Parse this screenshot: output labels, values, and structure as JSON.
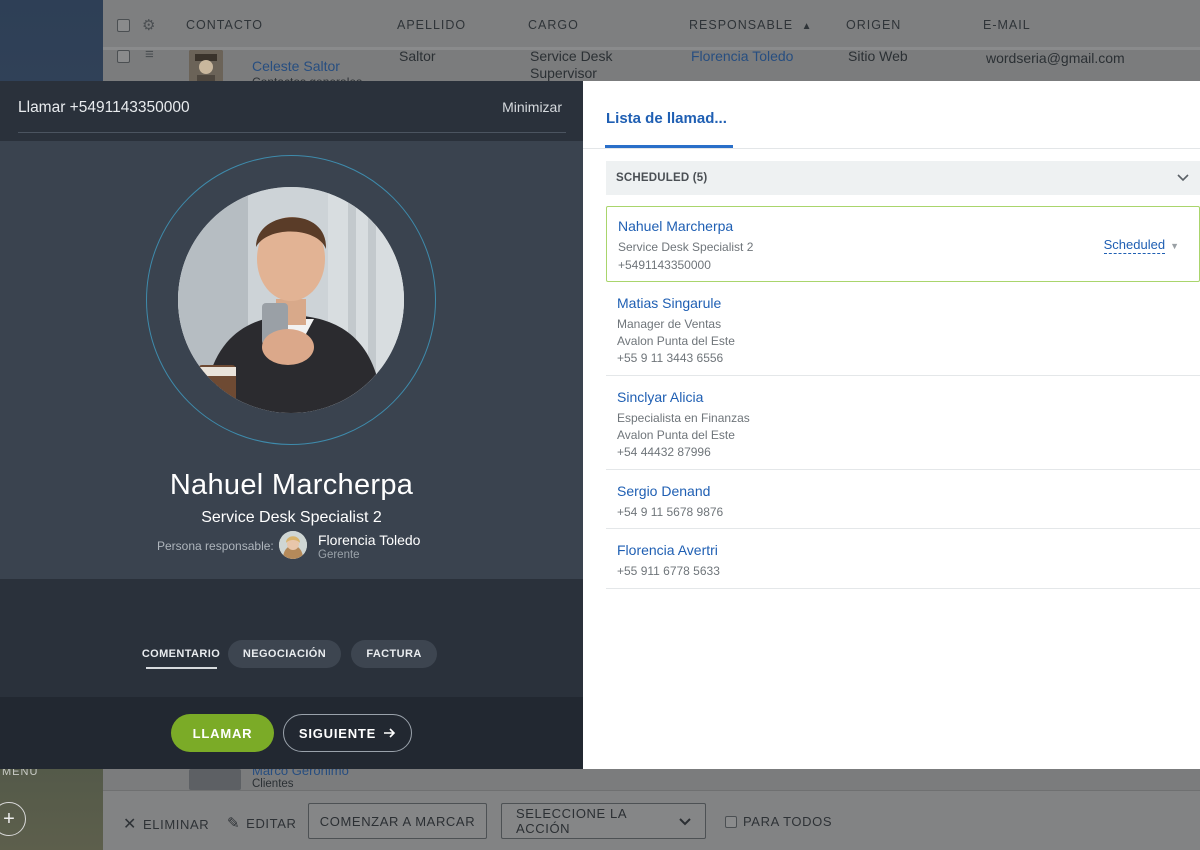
{
  "background": {
    "sidebar": {
      "menu_label": "MENU",
      "add_icon": "plus-icon"
    },
    "table": {
      "columns": [
        "CONTACTO",
        "APELLIDO",
        "CARGO",
        "RESPONSABLE",
        "ORIGEN",
        "E-MAIL"
      ],
      "row1": {
        "contact": "Celeste Saltor",
        "contact_sub": "Contactos generales",
        "apellido": "Saltor",
        "cargo_line1": "Service Desk",
        "cargo_line2": "Supervisor",
        "responsable": "Florencia Toledo",
        "origen": "Sitio Web",
        "email": "wordseria@gmail.com"
      },
      "row_bottom": {
        "contact": "Marco Geronimo",
        "contact_sub": "Clientes"
      }
    },
    "footer": {
      "delete_label": "ELIMINAR",
      "edit_label": "EDITAR",
      "dial_label": "COMENZAR A MARCAR",
      "action_select": "SELECCIONE LA ACCIÓN",
      "all_label": "PARA TODOS"
    }
  },
  "call": {
    "title": "Llamar +5491143350000",
    "minimize_label": "Minimizar",
    "contact": {
      "name": "Nahuel Marcherpa",
      "role": "Service Desk Specialist 2"
    },
    "responsible": {
      "label": "Persona responsable:",
      "name": "Florencia Toledo",
      "role": "Gerente"
    },
    "tabs": [
      "COMENTARIO",
      "NEGOCIACIÓN",
      "FACTURA"
    ],
    "active_tab": "COMENTARIO",
    "call_button": "LLAMAR",
    "next_button": "SIGUIENTE",
    "accent_color": "#7bab27"
  },
  "list": {
    "tab_label": "Lista de llamad...",
    "group_label": "SCHEDULED (5)",
    "items": [
      {
        "name": "Nahuel Marcherpa",
        "lines": [
          "Service Desk Specialist 2",
          "+5491143350000"
        ],
        "status": "Scheduled"
      },
      {
        "name": "Matias Singarule",
        "lines": [
          "Manager de Ventas",
          "Avalon Punta del Este",
          "+55 9 11 3443 6556"
        ]
      },
      {
        "name": "Sinclyar Alicia",
        "lines": [
          "Especialista en Finanzas",
          "Avalon Punta del Este",
          "+54 44432 87996"
        ]
      },
      {
        "name": "Sergio Denand",
        "lines": [
          "+54 9 11 5678 9876"
        ]
      },
      {
        "name": "Florencia Avertri",
        "lines": [
          "+55 911 6778 5633"
        ]
      }
    ],
    "link_color": "#1f5fb3",
    "active_border_color": "#a9d56c"
  }
}
